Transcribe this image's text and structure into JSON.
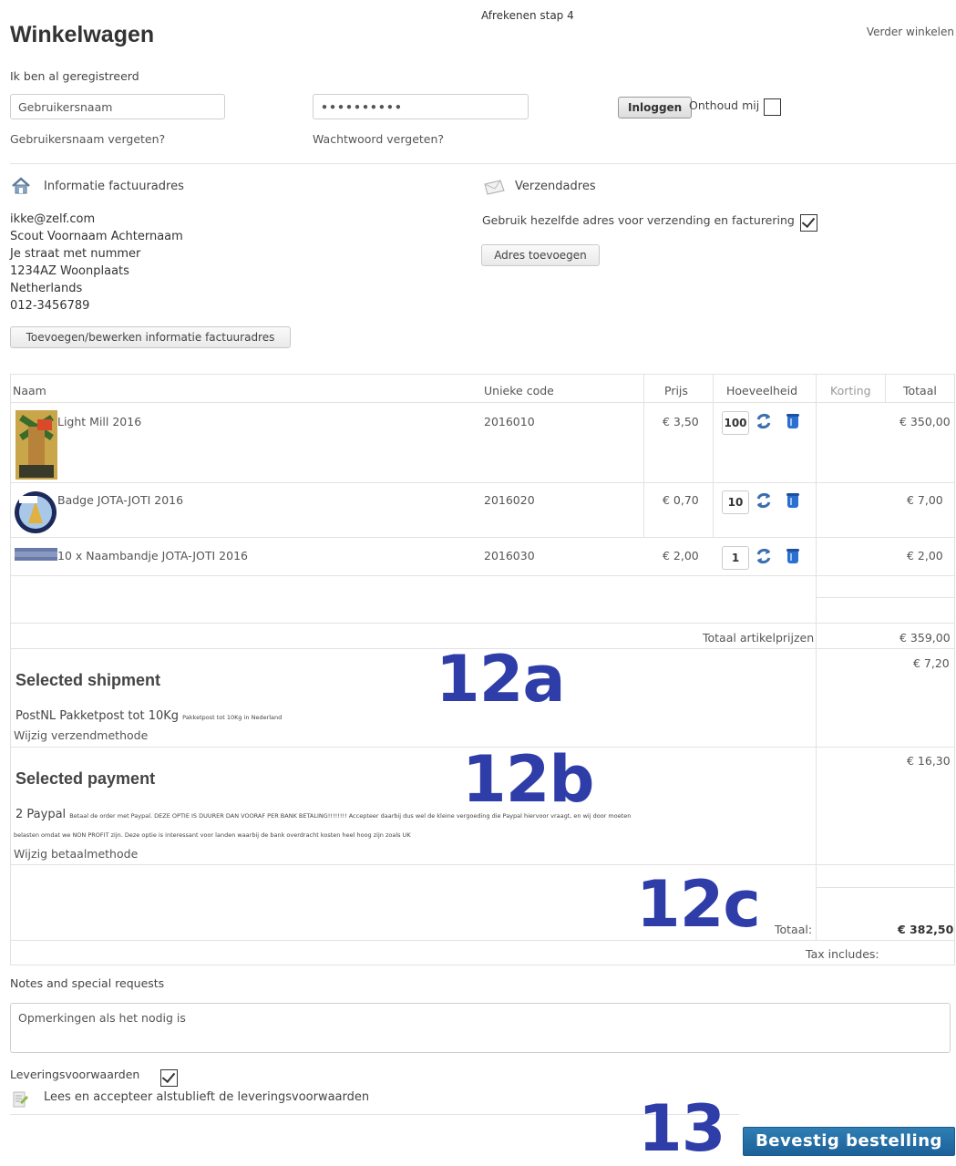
{
  "header": {
    "title": "Winkelwagen",
    "step": "Afrekenen stap 4",
    "continue_shopping": "Verder winkelen"
  },
  "login": {
    "registered_label": "Ik ben al geregistreerd",
    "username_value": "Gebruikersnaam",
    "password_value": "••••••••••",
    "login_button": "Inloggen",
    "remember_label": "Onthoud mij",
    "forgot_username": "Gebruikersnaam vergeten?",
    "forgot_password": "Wachtwoord vergeten?"
  },
  "billing": {
    "heading": "Informatie factuuradres",
    "lines": [
      "ikke@zelf.com",
      "Scout Voornaam Achternaam",
      "Je straat met nummer",
      "1234AZ Woonplaats",
      "Netherlands",
      "012-3456789"
    ],
    "edit_button": "Toevoegen/bewerken informatie factuuradres"
  },
  "shipping": {
    "heading": "Verzendadres",
    "same_address_label": "Gebruik hezelfde adres voor verzending en facturering",
    "add_address_button": "Adres toevoegen"
  },
  "table": {
    "headers": {
      "name": "Naam",
      "code": "Unieke code",
      "price": "Prijs",
      "qty": "Hoeveelheid",
      "discount": "Korting",
      "total": "Totaal"
    },
    "rows": [
      {
        "name": "Light Mill 2016",
        "code": "2016010",
        "price": "€ 3,50",
        "qty": "100",
        "total": "€ 350,00"
      },
      {
        "name": "Badge JOTA-JOTI 2016",
        "code": "2016020",
        "price": "€ 0,70",
        "qty": "10",
        "total": "€ 7,00"
      },
      {
        "name": "10 x Naambandje JOTA-JOTI 2016",
        "code": "2016030",
        "price": "€ 2,00",
        "qty": "1",
        "total": "€ 2,00"
      }
    ],
    "subtotal_label": "Totaal artikelprijzen",
    "subtotal_value": "€ 359,00",
    "shipment": {
      "title": "Selected shipment",
      "method": "PostNL Pakketpost tot 10Kg",
      "method_note": "Pakketpost tot 10Kg in Nederland",
      "change_link": "Wijzig verzendmethode",
      "cost": "€ 7,20"
    },
    "payment": {
      "title": "Selected payment",
      "method": "2 Paypal",
      "note_line1": "Betaal de order met Paypal. DEZE OPTIE IS DUURER DAN VOORAF PER BANK BETALING!!!!!!!! Accepteer daarbij dus wel de kleine vergoeding die Paypal hiervoor vraagt, en wij door moeten",
      "note_line2": "belasten omdat we NON PROFIT zijn. Deze optie is interessant voor landen waarbij de bank overdracht kosten heel hoog zijn zoals UK",
      "change_link": "Wijzig betaalmethode",
      "cost": "€ 16,30"
    },
    "total_label": "Totaal:",
    "total_value": "€ 382,50",
    "tax_label": "Tax includes:"
  },
  "annotations": {
    "a": "12a",
    "b": "12b",
    "c": "12c",
    "d": "13"
  },
  "notes": {
    "label": "Notes and special requests",
    "value": "Opmerkingen als het nodig is"
  },
  "terms": {
    "label": "Leveringsvoorwaarden",
    "accept_text": "Lees en accepteer alstublieft de leveringsvoorwaarden"
  },
  "confirm_button": "Bevestig bestelling"
}
